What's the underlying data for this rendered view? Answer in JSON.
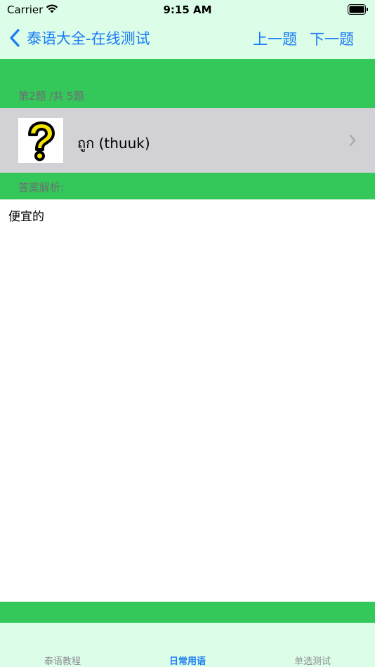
{
  "status": {
    "carrier": "Carrier",
    "time": "9:15 AM"
  },
  "nav": {
    "back_title": "泰语大全-在线测试",
    "prev_label": "上一题",
    "next_label": "下一题"
  },
  "question": {
    "counter": "第2题 /共 5题",
    "word": "ถูก (thuuk)"
  },
  "answer": {
    "label": "答案解析:",
    "text": "便宜的"
  },
  "tabs": [
    {
      "label": "泰语教程",
      "active": false
    },
    {
      "label": "日常用语",
      "active": true
    },
    {
      "label": "单选测试",
      "active": false
    }
  ],
  "colors": {
    "accent": "#1a7cf5",
    "green": "#34c759",
    "pale_green": "#dcfde8",
    "cell_gray": "#d1d1d6"
  },
  "icons": {
    "back": "chevron-left-icon",
    "thumb": "question-mark-icon",
    "disclosure": "chevron-right-icon"
  }
}
